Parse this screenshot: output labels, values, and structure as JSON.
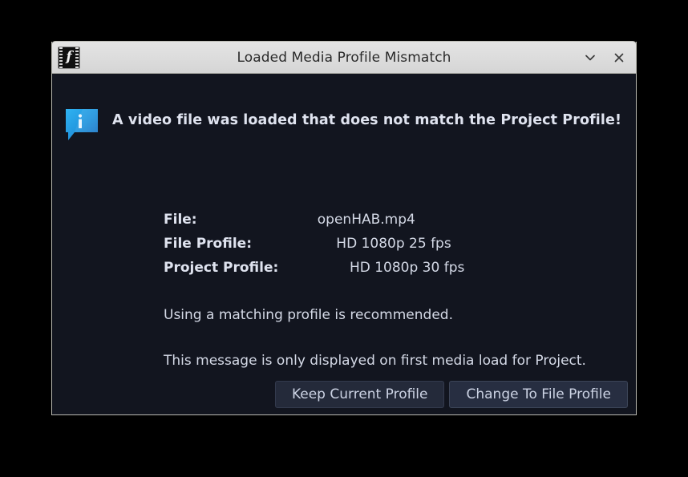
{
  "window": {
    "title": "Loaded Media Profile Mismatch",
    "app_icon": "film-strip-icon",
    "controls": [
      {
        "name": "shade-window-button",
        "icon": "chevron-down-icon"
      },
      {
        "name": "close-window-button",
        "icon": "close-icon"
      }
    ]
  },
  "dialog": {
    "icon": "info-bubble-icon",
    "icon_letter": "i",
    "headline": "A video file was loaded that does not match the Project Profile!",
    "rows": [
      {
        "label": "File:",
        "value": "openHAB.mp4"
      },
      {
        "label": "File Profile:",
        "value": "HD 1080p 25 fps"
      },
      {
        "label": "Project Profile:",
        "value": "HD 1080p 30 fps"
      }
    ],
    "paragraph_1": "Using a matching profile is recommended.",
    "paragraph_2": "This message is only displayed on first media load for Project.",
    "buttons": [
      {
        "name": "keep-current-profile-button",
        "label": "Keep Current Profile",
        "focused": false
      },
      {
        "name": "change-to-file-profile-button",
        "label": "Change To File Profile",
        "focused": true
      }
    ]
  },
  "colors": {
    "desktop_background": "#000000",
    "titlebar_background": "#dcdcdc",
    "dialog_background": "#12151f",
    "accent_info_icon": "#29a8e8",
    "text_primary": "#dfe3ef",
    "button_background": "#242a3a"
  }
}
